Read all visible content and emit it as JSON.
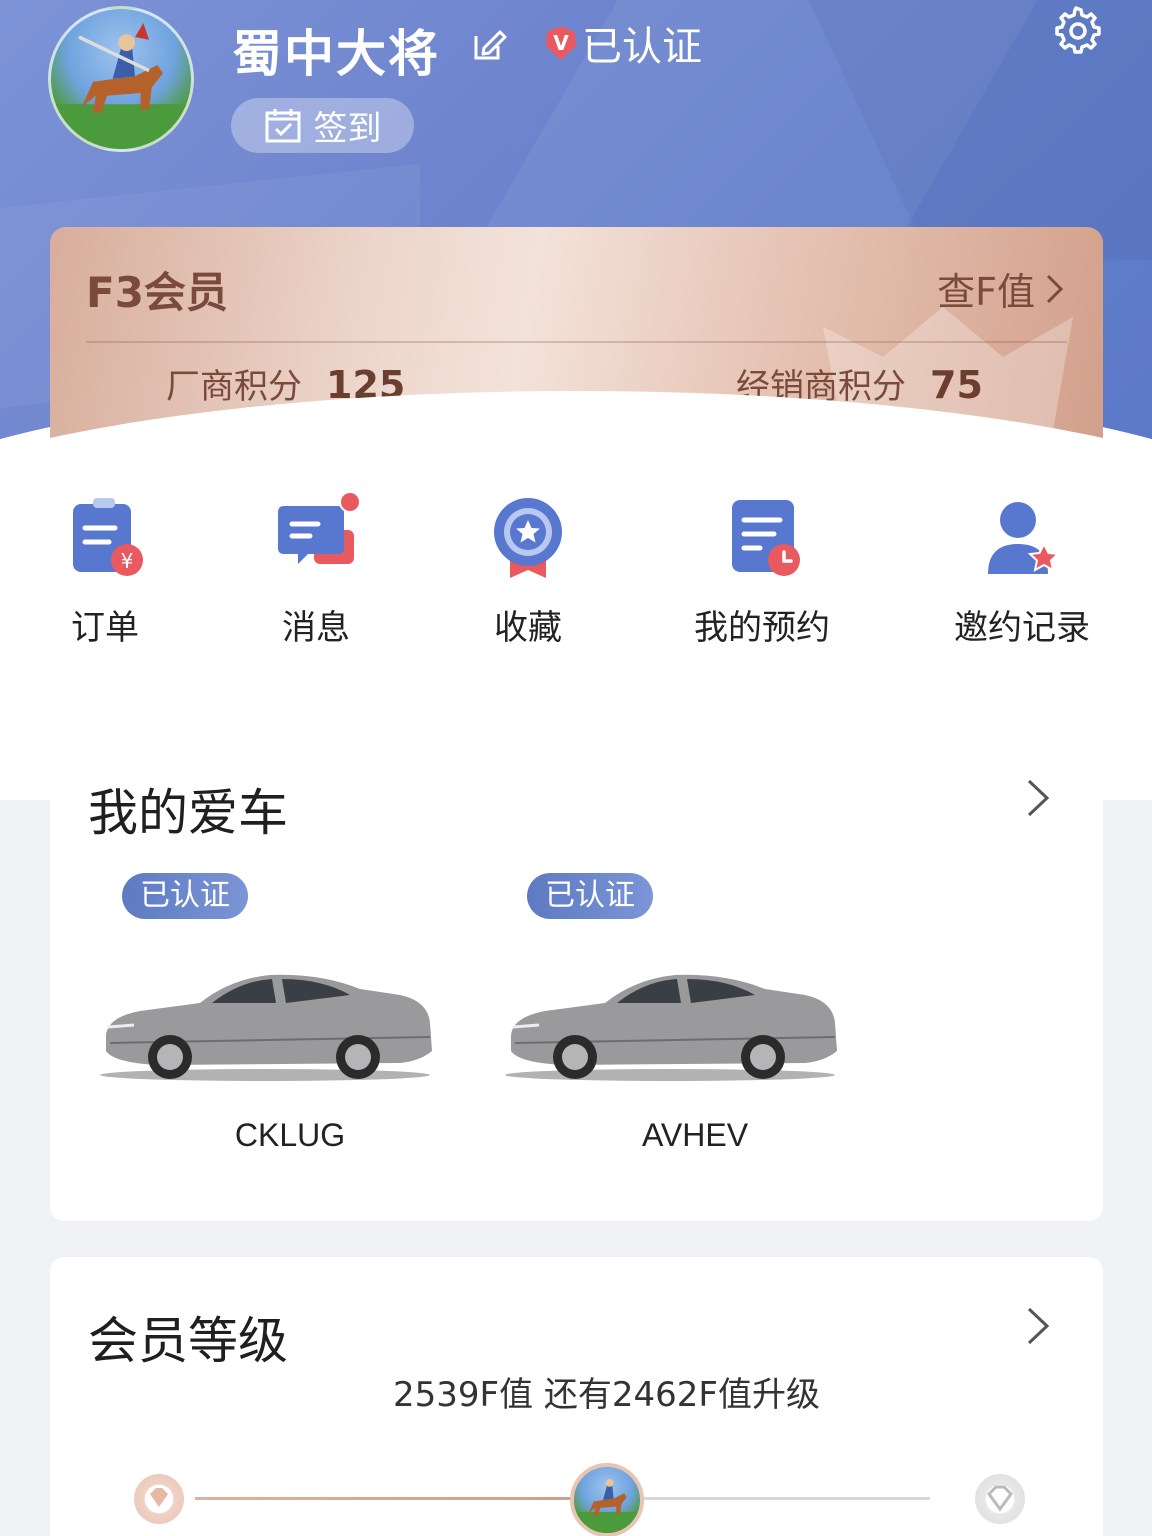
{
  "profile": {
    "username": "蜀中大将",
    "verified_label": "已认证",
    "checkin_label": "签到"
  },
  "member": {
    "level": "F3会员",
    "fvalue_link": "查F值",
    "manufacturer_points_label": "厂商积分",
    "manufacturer_points": "125",
    "dealer_points_label": "经销商积分",
    "dealer_points": "75"
  },
  "quick_menu": [
    {
      "label": "订单",
      "icon": "order-icon"
    },
    {
      "label": "消息",
      "icon": "message-icon"
    },
    {
      "label": "收藏",
      "icon": "favorite-icon"
    },
    {
      "label": "我的预约",
      "icon": "reservation-icon"
    },
    {
      "label": "邀约记录",
      "icon": "invitation-record-icon"
    }
  ],
  "my_cars": {
    "title": "我的爱车",
    "cars": [
      {
        "tag": "已认证",
        "name": "CKLUG"
      },
      {
        "tag": "已认证",
        "name": "AVHEV"
      }
    ]
  },
  "member_level": {
    "title": "会员等级",
    "description": "2539F值 还有2462F值升级"
  },
  "colors": {
    "header_blue": "#6f86cf",
    "card_rose": "#e5c1b1",
    "brand_text": "#7a4b3c",
    "accent_red": "#e85a5f"
  }
}
